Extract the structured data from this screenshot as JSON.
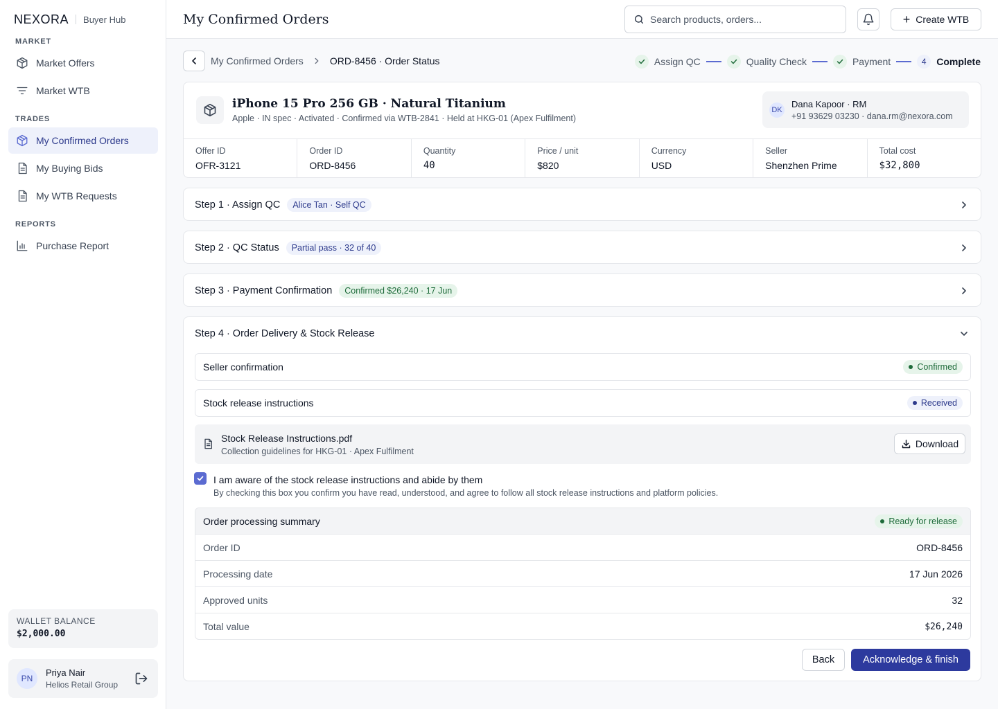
{
  "sidebar": {
    "brand": "NEXORA",
    "hub": "Buyer Hub",
    "sections": {
      "market": "MARKET",
      "trades": "TRADES",
      "reports": "REPORTS"
    },
    "items": {
      "market_offers": {
        "label": "Market Offers",
        "icon": "cube-icon"
      },
      "market_wtb": {
        "label": "Market WTB",
        "icon": "filter-lines-icon"
      },
      "confirmed_orders": {
        "label": "My Confirmed Orders",
        "icon": "cube-icon",
        "active": true
      },
      "buying_bids": {
        "label": "My Buying Bids",
        "icon": "document-icon"
      },
      "wtb_requests": {
        "label": "My WTB Requests",
        "icon": "document-icon"
      },
      "purchase_report": {
        "label": "Purchase Report",
        "icon": "bar-chart-icon"
      }
    },
    "wallet": {
      "label": "WALLET BALANCE",
      "value": "$2,000.00"
    },
    "user": {
      "initials": "PN",
      "name": "Priya Nair",
      "org": "Helios Retail Group"
    }
  },
  "header": {
    "title": "My Confirmed Orders",
    "search_placeholder": "Search products, orders...",
    "create_label": "Create WTB"
  },
  "breadcrumb": {
    "parent": "My Confirmed Orders",
    "current": "ORD-8456 · Order Status"
  },
  "stepper": {
    "steps": [
      "Assign QC",
      "Quality Check",
      "Payment",
      "Complete"
    ],
    "current_number": "4"
  },
  "order": {
    "title": "iPhone 15 Pro 256 GB · Natural Titanium",
    "subtitle": "Apple · IN spec · Activated · Confirmed via WTB-2841 · Held at HKG-01 (Apex Fulfilment)",
    "rm": {
      "initials": "DK",
      "name": "Dana Kapoor · RM",
      "contact": "+91 93629 03230 · dana.rm@nexora.com"
    },
    "stats": [
      {
        "label": "Offer ID",
        "value": "OFR-3121"
      },
      {
        "label": "Order ID",
        "value": "ORD-8456"
      },
      {
        "label": "Quantity",
        "value": "40"
      },
      {
        "label": "Price / unit",
        "value": "$820"
      },
      {
        "label": "Currency",
        "value": "USD"
      },
      {
        "label": "Seller",
        "value": "Shenzhen Prime"
      },
      {
        "label": "Total cost",
        "value": "$32,800"
      }
    ]
  },
  "steps": {
    "step1": {
      "title": "Step 1 · Assign QC",
      "badge": "Alice Tan · Self QC"
    },
    "step2": {
      "title": "Step 2 · QC Status",
      "badge": "Partial pass · 32 of 40"
    },
    "step3": {
      "title": "Step 3 · Payment Confirmation",
      "badge": "Confirmed $26,240 · 17 Jun"
    },
    "step4": {
      "title": "Step 4 · Order Delivery & Stock Release",
      "seller_confirmation": {
        "label": "Seller confirmation",
        "status": "Confirmed"
      },
      "stock_release": {
        "label": "Stock release instructions",
        "status": "Received"
      },
      "file": {
        "name": "Stock Release Instructions.pdf",
        "desc": "Collection guidelines for HKG-01 · Apex Fulfilment",
        "download_label": "Download"
      },
      "acknowledge": {
        "checked": true,
        "label": "I am aware of the stock release instructions and abide by them",
        "sub": "By checking this box you confirm you have read, understood, and agree to follow all stock release instructions and platform policies."
      },
      "summary": {
        "title": "Order processing summary",
        "status": "Ready for release",
        "rows": [
          {
            "label": "Order ID",
            "value": "ORD-8456"
          },
          {
            "label": "Processing date",
            "value": "17 Jun 2026"
          },
          {
            "label": "Approved units",
            "value": "32"
          },
          {
            "label": "Total value",
            "value": "$26,240"
          }
        ]
      },
      "back_label": "Back",
      "finish_label": "Acknowledge & finish"
    }
  },
  "colors": {
    "accent": "#2d3a9e",
    "accent_light": "#eef1fb",
    "success": "#1e6b3a",
    "success_light": "#e6f4ea",
    "checkbox": "#5b6bd1"
  }
}
